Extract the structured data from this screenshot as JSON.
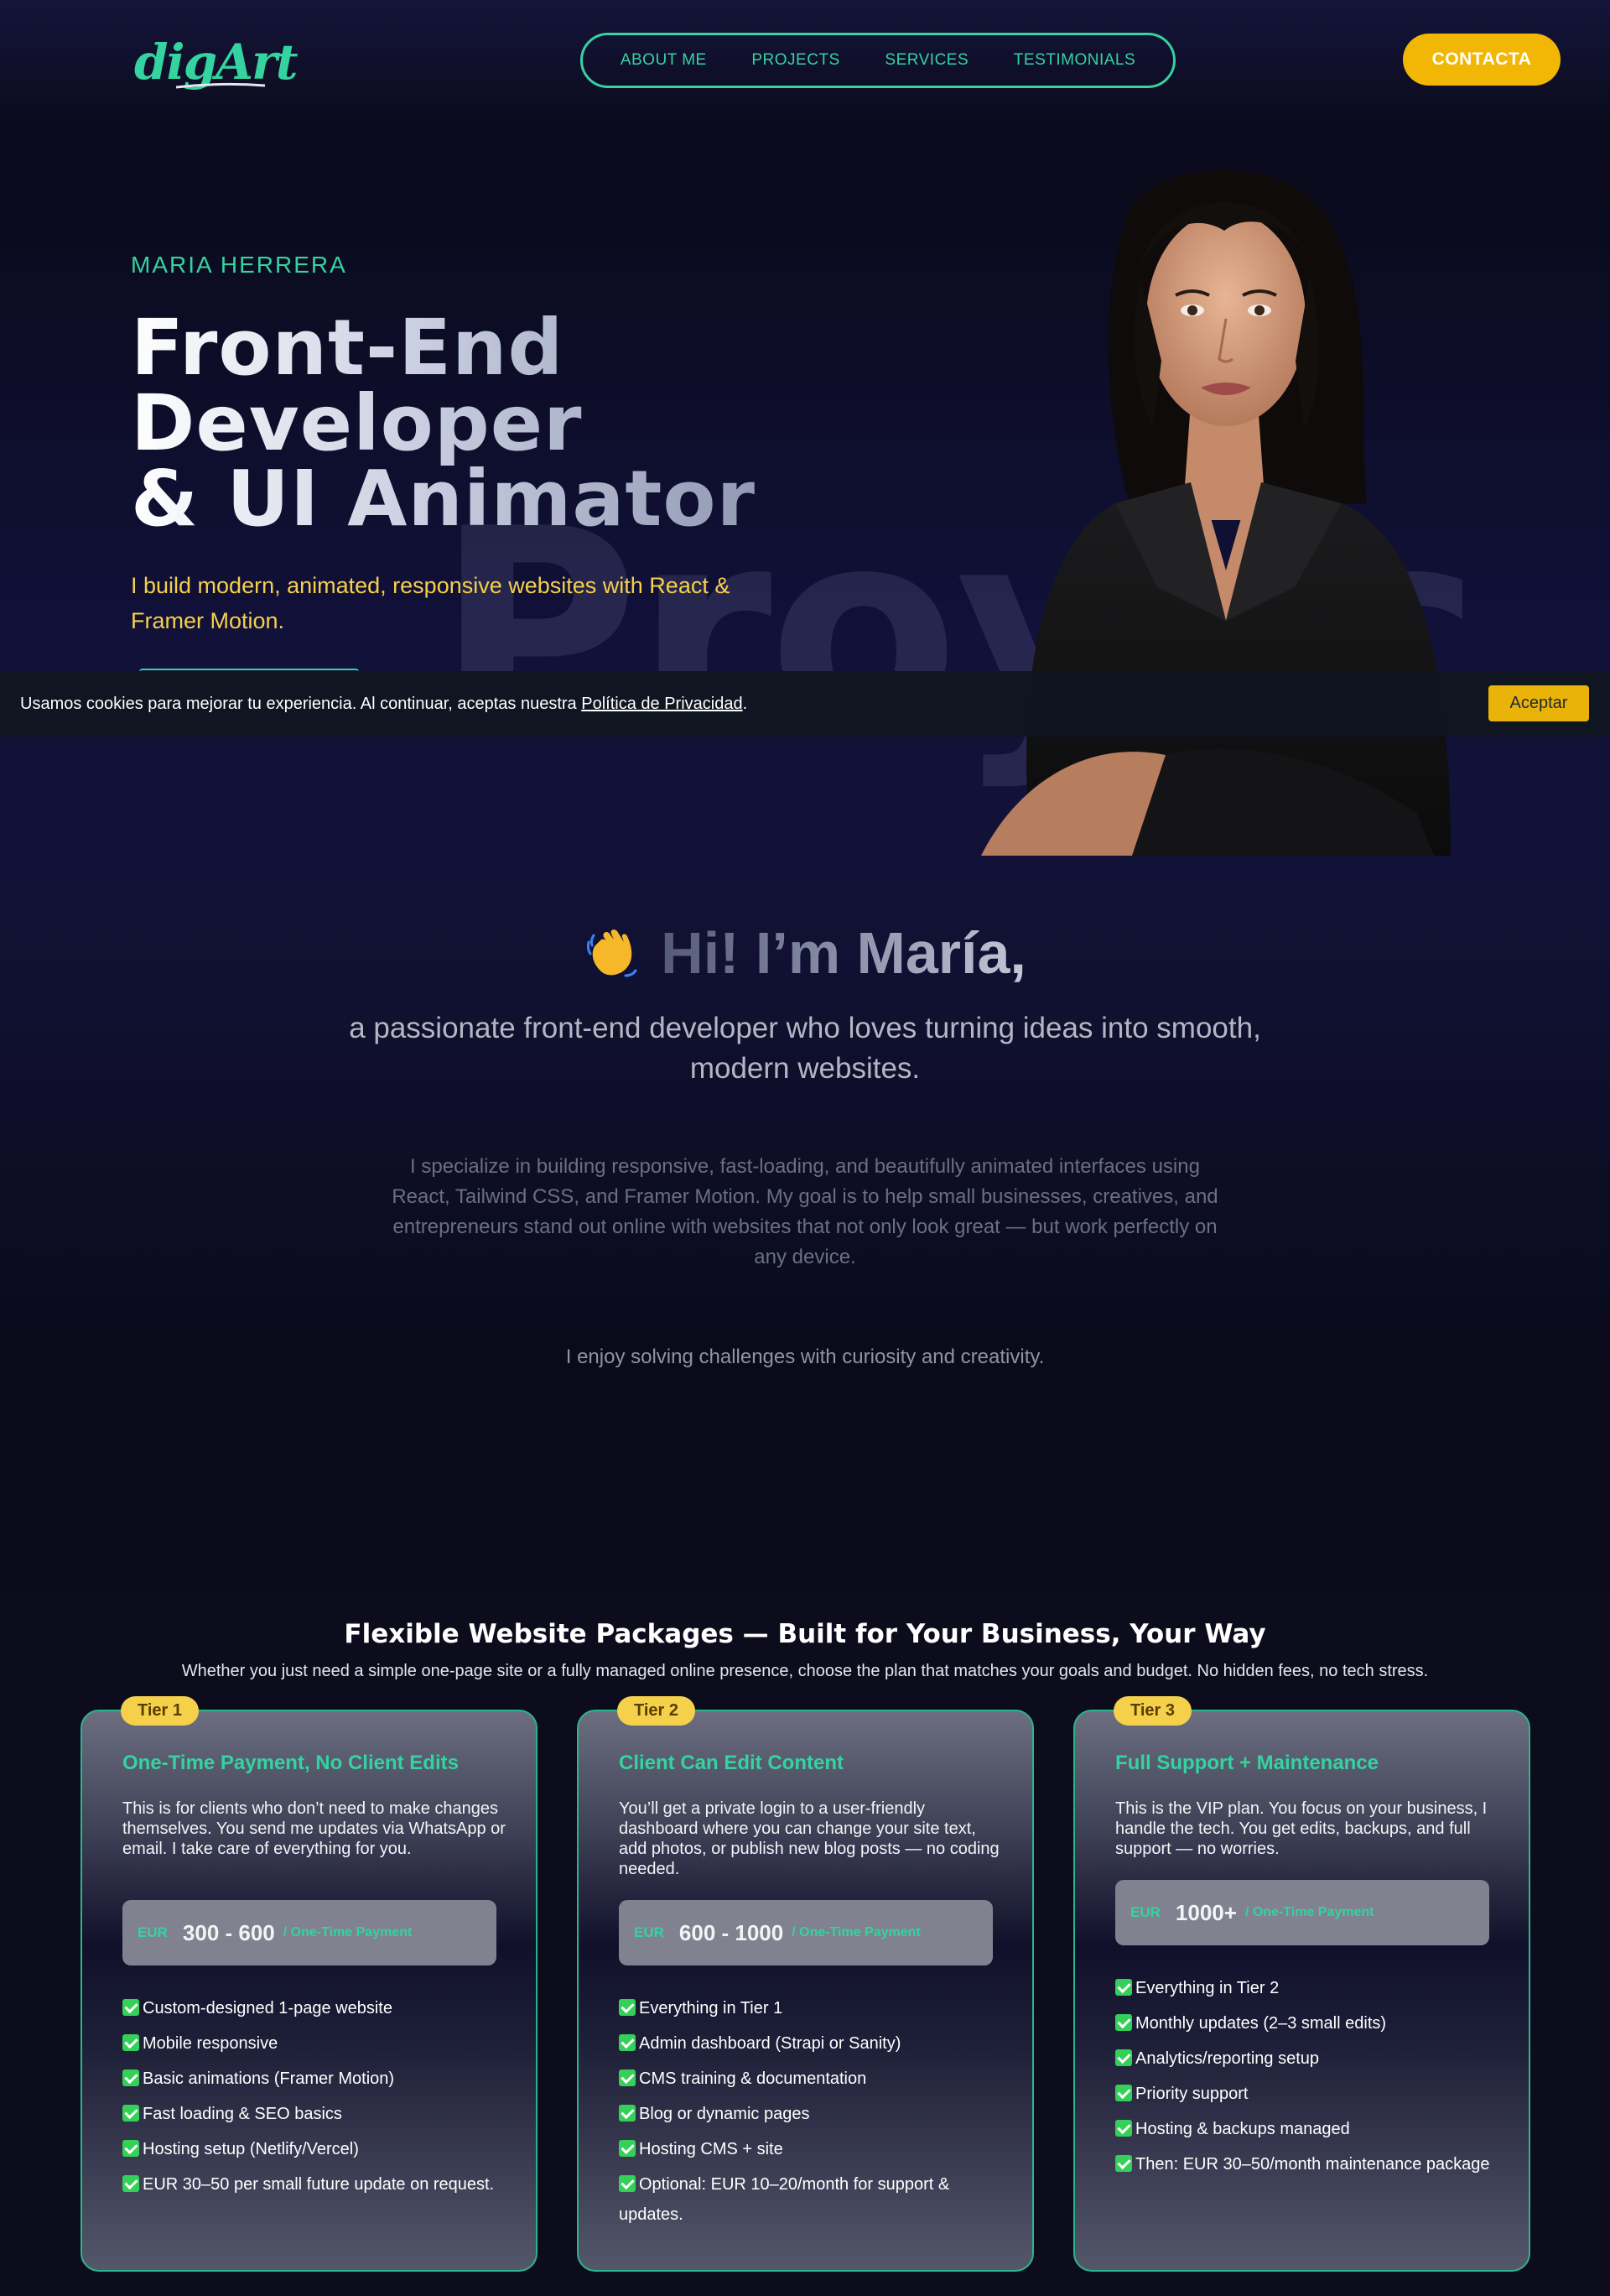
{
  "nav": {
    "logo_text": "digArt",
    "links": [
      "ABOUT ME",
      "PROJECTS",
      "SERVICES",
      "TESTIMONIALS"
    ],
    "cta_label": "CONTACTA",
    "accent_color": "#34d3a0",
    "cta_color": "#f2b705"
  },
  "hero": {
    "name": "MARIA HERRERA",
    "title_lines": [
      "Front-End",
      "Developer",
      "& UI Animator"
    ],
    "background_word": "Proyec",
    "subtitle": "I build modern, animated, responsive websites with React & Framer Motion.",
    "subtitle_color": "#f5d04a"
  },
  "cookie": {
    "text": "Usamos cookies para mejorar tu experiencia. Al continuar, aceptas nuestra ",
    "link": "Política de Privacidad",
    "suffix": ".",
    "button": "Aceptar"
  },
  "about": {
    "greeting": "Hi! I’m María,",
    "wave_icon": "waving-hand-icon",
    "lead": "a passionate front-end developer who loves turning ideas into smooth, modern websites.",
    "body": "I specialize in building responsive, fast-loading, and beautifully animated interfaces using React, Tailwind CSS, and Framer Motion. My goal is to help small businesses, creatives, and entrepreneurs stand out online with websites that not only look great — but work perfectly on any device.",
    "note": "I enjoy solving challenges with curiosity and creativity."
  },
  "packages": {
    "title": "Flexible Website Packages — Built for Your Business, Your Way",
    "subtitle": "Whether you just need a simple one-page site or a fully managed online presence, choose the plan that matches your goals and budget. No hidden fees, no tech stress.",
    "tiers": [
      {
        "badge": "Tier 1",
        "heading": "One-Time Payment, No Client Edits",
        "description": "This is for clients who don’t need to make changes themselves. You send me updates via WhatsApp or email. I take care of everything for you.",
        "currency": "EUR",
        "price": "300 - 600",
        "price_note": "/ One-Time Payment",
        "features": [
          "Custom-designed 1-page website",
          "Mobile responsive",
          "Basic animations (Framer Motion)",
          "Fast loading & SEO basics",
          "Hosting setup (Netlify/Vercel)",
          "EUR 30–50 per small future update on request."
        ]
      },
      {
        "badge": "Tier 2",
        "heading": "Client Can Edit Content",
        "description": "You’ll get a private login to a user-friendly dashboard where you can change your site text, add photos, or publish new blog posts — no coding needed.",
        "currency": "EUR",
        "price": "600 - 1000",
        "price_note": "/ One-Time Payment",
        "features": [
          "Everything in Tier 1",
          "Admin dashboard (Strapi or Sanity)",
          "CMS training & documentation",
          "Blog or dynamic pages",
          "Hosting CMS + site",
          "Optional: EUR 10–20/month for support & updates."
        ]
      },
      {
        "badge": "Tier 3",
        "heading": "Full Support + Maintenance",
        "description": "This is the VIP plan. You focus on your business, I handle the tech. You get edits, backups, and full support — no worries.",
        "currency": "EUR",
        "price": "1000+",
        "price_note": "/ One-Time Payment",
        "features": [
          "Everything in Tier 2",
          "Monthly updates (2–3 small edits)",
          "Analytics/reporting setup",
          "Priority support",
          "Hosting & backups managed",
          "Then: EUR 30–50/month maintenance package"
        ]
      }
    ]
  }
}
